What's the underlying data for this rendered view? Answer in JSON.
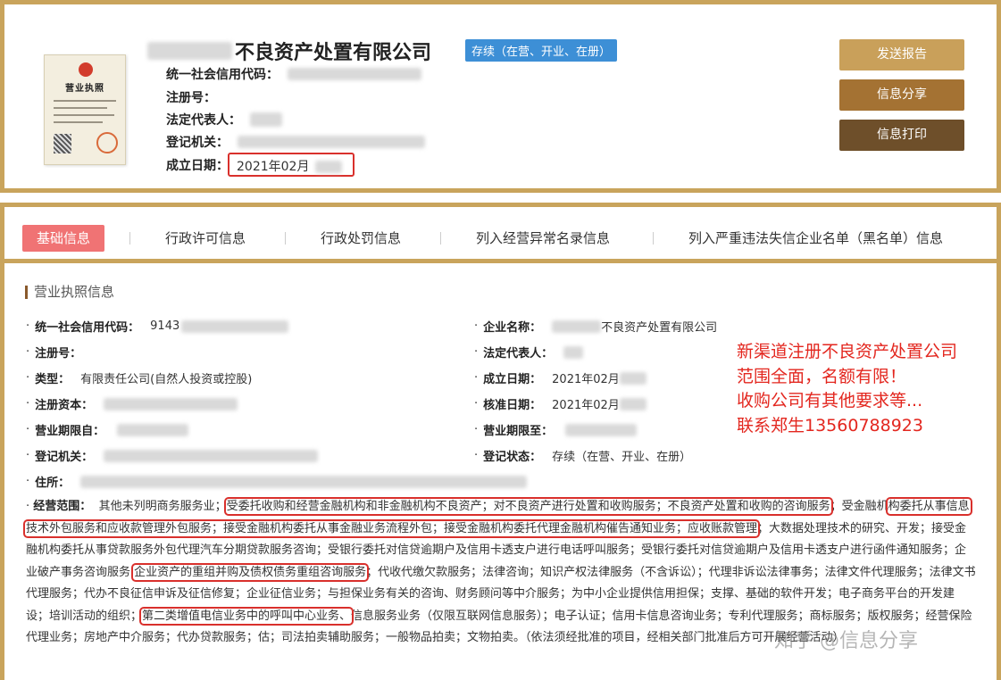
{
  "header": {
    "company_name": "不良资产处置有限公司",
    "status_badge": "存续（在营、开业、在册）",
    "fields": {
      "credit_code_label": "统一社会信用代码：",
      "reg_no_label": "注册号：",
      "legal_rep_label": "法定代表人：",
      "reg_authority_label": "登记机关：",
      "established_label": "成立日期：",
      "established_value": "2021年02月"
    },
    "license_title": "营业执照",
    "buttons": {
      "send_report": "发送报告",
      "share_info": "信息分享",
      "print_info": "信息打印"
    }
  },
  "tabs": [
    {
      "label": "基础信息",
      "active": true
    },
    {
      "label": "行政许可信息",
      "active": false
    },
    {
      "label": "行政处罚信息",
      "active": false
    },
    {
      "label": "列入经营异常名录信息",
      "active": false
    },
    {
      "label": "列入严重违法失信企业名单（黑名单）信息",
      "active": false
    }
  ],
  "section": {
    "title": "营业执照信息",
    "left": [
      {
        "label": "统一社会信用代码：",
        "value": "9143"
      },
      {
        "label": "注册号：",
        "value": ""
      },
      {
        "label": "类型：",
        "value": "有限责任公司(自然人投资或控股)"
      },
      {
        "label": "注册资本：",
        "value": ""
      },
      {
        "label": "营业期限自：",
        "value": ""
      },
      {
        "label": "登记机关：",
        "value": ""
      },
      {
        "label": "住所：",
        "value": ""
      }
    ],
    "right": [
      {
        "label": "企业名称：",
        "value": "不良资产处置有限公司"
      },
      {
        "label": "法定代表人：",
        "value": ""
      },
      {
        "label": "成立日期：",
        "value": "2021年02月"
      },
      {
        "label": "核准日期：",
        "value": "2021年02月"
      },
      {
        "label": "营业期限至：",
        "value": ""
      },
      {
        "label": "登记状态：",
        "value": "存续（在营、开业、在册）"
      }
    ],
    "scope_label": "经营范围：",
    "scope_parts": [
      "其他未列明商务服务业；",
      "受委托收购和经营金融机构和非金融机构不良资产；对不良资产进行处置和收购服务；不良资产处置和收购的咨询服务",
      "；受金融机",
      "构委托从事信息技术外包服务和应收款管理外包服务；接受金融机构委托从事金融业务流程外包；接受金融机构委托代理金融机构催告通知业务；应收账款管理",
      "；大数据处理技术的研究、开发；接受金融机构委托从事贷款服务外包代理汽车分期贷款服务咨询；受银行委托对信贷逾期户及信用卡透支户进行电话呼叫服务；受银行委托对信贷逾期户及信用卡透支户进行函件通知服务；企业破产事务咨询服务",
      "企业资产的重组并购及债权债务重组咨询服务",
      "；代收代缴欠款服务；法律咨询；知识产权法律服务（不含诉讼）；代理非诉讼法律事务；法律文件代理服务；法律文书代理服务；代办不良征信申诉及征信修复；企业征信业务；与担保业务有关的咨询、财务顾问等中介服务；为中小企业提供信用担保；支撑、基础的软件开发；电子商务平台的开发建设；培训活动的组织；",
      "第二类增值电信业务中的呼叫中心业务、",
      "信息服务业务（仅限互联网信息服务）；电子认证；信用卡信息咨询业务；专利代理服务；商标服务；版权服务；经营保险代理业务；房地产中介服务；代办贷款服务；",
      "估；司法拍卖辅助服务；一般物品拍卖；文物拍卖。（依法须经批准的项目，经相关部门批准后方可开展经营活动）"
    ]
  },
  "promo": [
    "新渠道注册不良资产处置公司",
    "范围全面，名额有限！",
    "收购公司有其他要求等...",
    "联系郑生13560788923"
  ],
  "watermark": "知乎 @信息分享"
}
